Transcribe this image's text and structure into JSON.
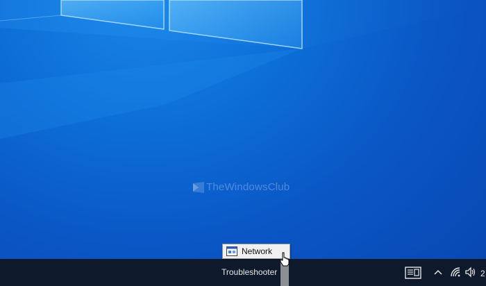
{
  "watermark": {
    "text": "TheWindowsClub"
  },
  "taskbar": {
    "toolbar_label": "Troubleshooter",
    "clock_partial": "2",
    "icons": {
      "notification": "action-center-icon",
      "overflow": "chevron-up-icon",
      "network": "wifi-icon",
      "volume": "speaker-icon"
    }
  },
  "menu": {
    "item_label": "Network",
    "item_icon": "network-window-icon"
  },
  "colors": {
    "taskbar": "#0e1a2c",
    "wallpaper_blue": "#0a57c6",
    "tooltip_bg": "#f0f0f0"
  }
}
